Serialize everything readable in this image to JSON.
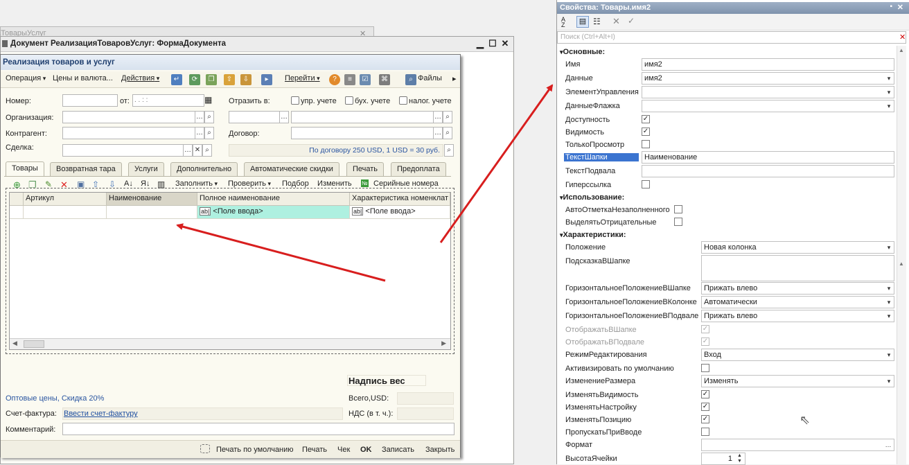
{
  "bg_window": {
    "title": "аТоварыУслуг"
  },
  "dialog": {
    "title": "Документ РеализацияТоваровУслуг: ФормаДокумента"
  },
  "form": {
    "header": "Реализация товаров и услуг",
    "toolbar": {
      "operation": "Операция",
      "prices": "Цены и валюта...",
      "actions": "Действия",
      "goto": "Перейти",
      "files": "Файлы"
    },
    "fields": {
      "number_label": "Номер:",
      "from_label": "от:",
      "date_mask": " .  .     :  :",
      "reflect_label": "Отразить в:",
      "mgmt": "упр. учете",
      "acc": "бух. учете",
      "tax": "налог. учете",
      "org_label": "Организация:",
      "counterparty_label": "Контрагент:",
      "contract_label": "Договор:",
      "deal_label": "Сделка:",
      "contract_info": "По договору 250 USD, 1 USD = 30 руб."
    },
    "tabs": [
      "Товары",
      "Возвратная тара",
      "Услуги",
      "Дополнительно",
      "Автоматические скидки",
      "Печать",
      "Предоплата"
    ],
    "grid_toolbar": {
      "fill": "Заполнить",
      "check": "Проверить",
      "select": "Подбор",
      "change": "Изменить",
      "serial": "Серийные номера"
    },
    "grid": {
      "columns": [
        "Артикул",
        "Наименование",
        "Полное наименование",
        "Характеристика номенклат"
      ],
      "row": [
        "",
        "",
        "<Поле ввода>",
        "<Поле ввода>"
      ]
    },
    "weight_label": "Надпись вес",
    "prices_link": "Оптовые цены, Скидка 20%",
    "total_label": "Всего,USD:",
    "vat_label": "НДС (в т. ч.):",
    "invoice_label": "Счет-фактура:",
    "invoice_link": "Ввести счет-фактуру",
    "comment_label": "Комментарий:",
    "footer": {
      "print_default": "Печать по умолчанию",
      "print": "Печать",
      "check": "Чек",
      "ok": "OK",
      "save": "Записать",
      "close": "Закрыть"
    }
  },
  "props": {
    "title": "Свойства: Товары.имя2",
    "search_placeholder": "Поиск (Ctrl+Alt+I)",
    "sec_main": "Основные:",
    "name_l": "Имя",
    "name_v": "имя2",
    "data_l": "Данные",
    "data_v": "имя2",
    "ctrl_l": "ЭлементУправления",
    "flagdata_l": "ДанныеФлажка",
    "avail_l": "Доступность",
    "visible_l": "Видимость",
    "readonly_l": "ТолькоПросмотр",
    "headertext_l": "ТекстШапки",
    "headertext_v": "Наименование",
    "footertext_l": "ТекстПодвала",
    "hyperlink_l": "Гиперссылка",
    "sec_use": "Использование:",
    "autoempty_l": "АвтоОтметкаНезаполненного",
    "negative_l": "ВыделятьОтрицательные",
    "sec_char": "Характеристики:",
    "pos_l": "Положение",
    "pos_v": "Новая колонка",
    "hint_l": "ПодсказкаВШапке",
    "halignhead_l": "ГоризонтальноеПоложениеВШапке",
    "halignhead_v": "Прижать влево",
    "haligncol_l": "ГоризонтальноеПоложениеВКолонке",
    "haligncol_v": "Автоматически",
    "halignfoot_l": "ГоризонтальноеПоложениеВПодвале",
    "halignfoot_v": "Прижать влево",
    "showhead_l": "ОтображатьВШапке",
    "showfoot_l": "ОтображатьВПодвале",
    "editmode_l": "РежимРедактирования",
    "editmode_v": "Вход",
    "activate_l": "Активизировать по умолчанию",
    "resize_l": "ИзменениеРазмера",
    "resize_v": "Изменять",
    "chvis_l": "ИзменятьВидимость",
    "chset_l": "ИзменятьНастройку",
    "chpos_l": "ИзменятьПозицию",
    "skip_l": "ПропускатьПриВводе",
    "format_l": "Формат",
    "rowh_l": "ВысотаЯчейки",
    "rowh_v": "1"
  },
  "colors": {
    "arrow": "#d81e1e",
    "header_blue": "#1f3f6f",
    "link": "#1f4fa0"
  }
}
